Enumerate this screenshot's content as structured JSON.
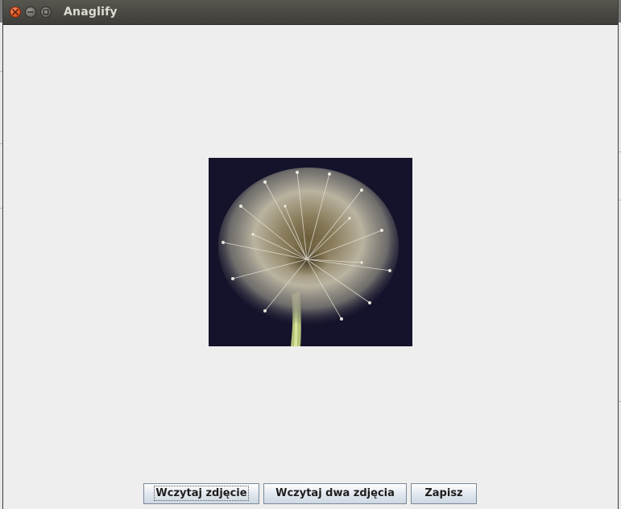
{
  "window": {
    "title": "Anaglify"
  },
  "image": {
    "subject": "dandelion seed head photo"
  },
  "buttons": {
    "load_photo": "Wczytaj zdjęcie",
    "load_two_photos": "Wczytaj dwa zdjęcia",
    "save": "Zapisz"
  },
  "colors": {
    "titlebar": "#4a4944",
    "close_button": "#e2571e",
    "content_background": "#eeeeee",
    "image_background": "#14132b"
  }
}
